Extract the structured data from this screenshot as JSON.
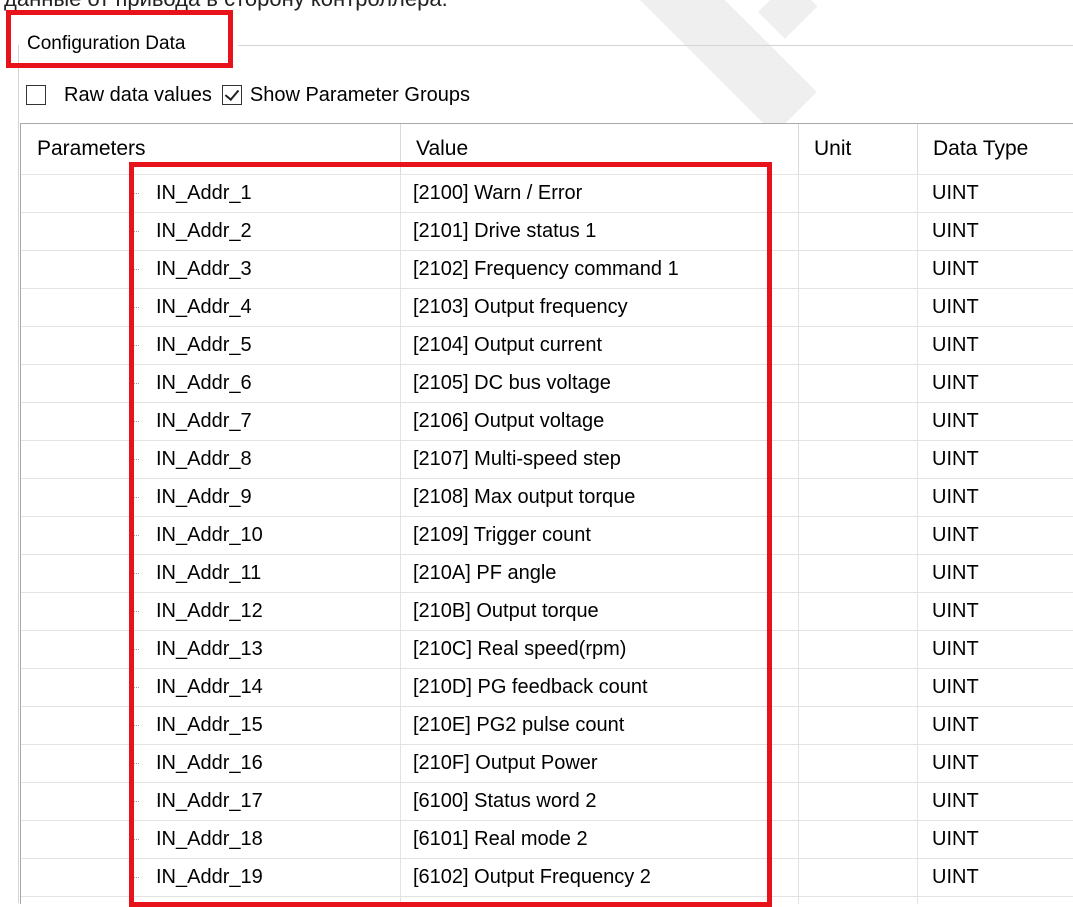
{
  "top_caption": "данные от привода в сторону контроллера.",
  "group_title": "Configuration Data",
  "options": {
    "raw_data_label": "Raw data values",
    "raw_data_checked": false,
    "show_groups_label": "Show Parameter Groups",
    "show_groups_checked": true
  },
  "columns": [
    "Parameters",
    "Value",
    "Unit",
    "Data Type"
  ],
  "rows": [
    {
      "param": "IN_Addr_1",
      "value": "[2100] Warn / Error",
      "unit": "",
      "type": "UINT"
    },
    {
      "param": "IN_Addr_2",
      "value": "[2101] Drive status 1",
      "unit": "",
      "type": "UINT"
    },
    {
      "param": "IN_Addr_3",
      "value": "[2102] Frequency command 1",
      "unit": "",
      "type": "UINT"
    },
    {
      "param": "IN_Addr_4",
      "value": "[2103] Output frequency",
      "unit": "",
      "type": "UINT"
    },
    {
      "param": "IN_Addr_5",
      "value": "[2104] Output current",
      "unit": "",
      "type": "UINT"
    },
    {
      "param": "IN_Addr_6",
      "value": "[2105] DC bus voltage",
      "unit": "",
      "type": "UINT"
    },
    {
      "param": "IN_Addr_7",
      "value": "[2106] Output voltage",
      "unit": "",
      "type": "UINT"
    },
    {
      "param": "IN_Addr_8",
      "value": "[2107] Multi-speed step",
      "unit": "",
      "type": "UINT"
    },
    {
      "param": "IN_Addr_9",
      "value": "[2108] Max output torque",
      "unit": "",
      "type": "UINT"
    },
    {
      "param": "IN_Addr_10",
      "value": "[2109] Trigger count",
      "unit": "",
      "type": "UINT"
    },
    {
      "param": "IN_Addr_11",
      "value": "[210A] PF angle",
      "unit": "",
      "type": "UINT"
    },
    {
      "param": "IN_Addr_12",
      "value": "[210B] Output torque",
      "unit": "",
      "type": "UINT"
    },
    {
      "param": "IN_Addr_13",
      "value": "[210C] Real speed(rpm)",
      "unit": "",
      "type": "UINT"
    },
    {
      "param": "IN_Addr_14",
      "value": "[210D] PG feedback count",
      "unit": "",
      "type": "UINT"
    },
    {
      "param": "IN_Addr_15",
      "value": "[210E] PG2 pulse count",
      "unit": "",
      "type": "UINT"
    },
    {
      "param": "IN_Addr_16",
      "value": "[210F] Output Power",
      "unit": "",
      "type": "UINT"
    },
    {
      "param": "IN_Addr_17",
      "value": "[6100] Status word 2",
      "unit": "",
      "type": "UINT"
    },
    {
      "param": "IN_Addr_18",
      "value": "[6101] Real mode 2",
      "unit": "",
      "type": "UINT"
    },
    {
      "param": "IN_Addr_19",
      "value": "[6102] Output Frequency 2",
      "unit": "",
      "type": "UINT"
    }
  ],
  "colors": {
    "highlight": "#e8121a",
    "grid_line": "#e3e3e3",
    "header_border": "#a9a9a9"
  }
}
